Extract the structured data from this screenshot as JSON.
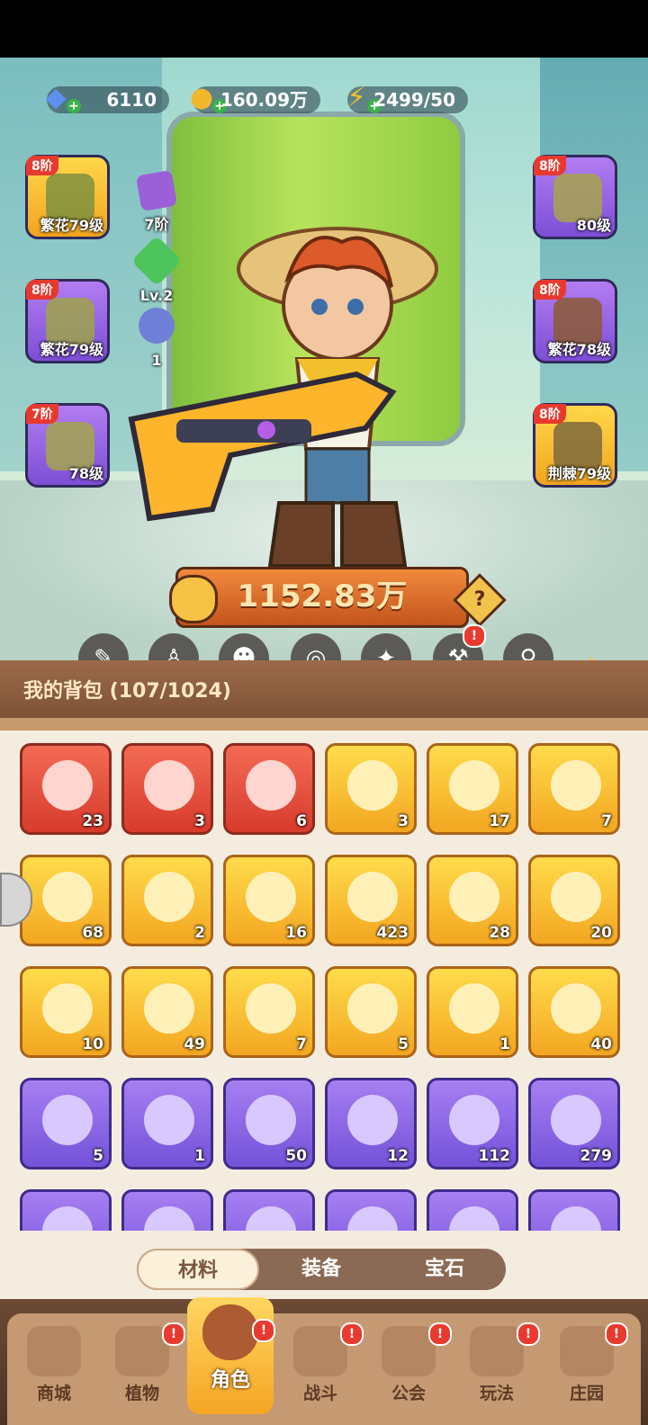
{
  "resources": [
    {
      "name": "diamond",
      "icon": "diamond-icon",
      "value": "6110"
    },
    {
      "name": "coin",
      "icon": "coin-icon",
      "value": "160.09万"
    },
    {
      "name": "energy",
      "icon": "lightning-icon",
      "value": "2499/50"
    }
  ],
  "equipment_left": [
    {
      "tier": "8阶",
      "level": "繁花79级",
      "color": "gold",
      "icon": "hat-icon"
    },
    {
      "tier": "8阶",
      "level": "繁花79级",
      "color": "purple",
      "icon": "gloves-icon"
    },
    {
      "tier": "7阶",
      "level": "78级",
      "color": "purple",
      "icon": "shorts-icon"
    }
  ],
  "equipment_right": [
    {
      "tier": "8阶",
      "level": "80级",
      "color": "purple",
      "icon": "jacket-icon"
    },
    {
      "tier": "8阶",
      "level": "繁花78级",
      "color": "purple",
      "icon": "belt-icon"
    },
    {
      "tier": "8阶",
      "level": "荆棘79级",
      "color": "gold",
      "icon": "boots-icon"
    }
  ],
  "mini_items": [
    {
      "label": "7阶",
      "icon": "pet-box-icon"
    },
    {
      "label": "Lv.2",
      "icon": "green-gem-icon"
    },
    {
      "label": "1",
      "icon": "cosmic-orb-icon"
    }
  ],
  "power": {
    "value": "1152.83万",
    "help": "?"
  },
  "tabs": [
    {
      "label": "武器",
      "icon": "weapon-icon",
      "alert": false
    },
    {
      "label": "时装",
      "icon": "costume-icon",
      "alert": false
    },
    {
      "label": "宠物",
      "icon": "pet-icon",
      "alert": false
    },
    {
      "label": "装饰",
      "icon": "mask-icon",
      "alert": false
    },
    {
      "label": "天赋",
      "icon": "talent-icon",
      "alert": false
    },
    {
      "label": "装备",
      "icon": "equipment-icon",
      "alert": true
    },
    {
      "label": "体魄",
      "icon": "physique-icon",
      "alert": false
    }
  ],
  "bag": {
    "title": "我的背包 (107/1024)"
  },
  "items": [
    {
      "count": "23",
      "color": "red",
      "icon": "star-crystal-icon"
    },
    {
      "count": "3",
      "color": "red",
      "icon": "red-potion-icon"
    },
    {
      "count": "6",
      "color": "red",
      "icon": "green-capsule-icon"
    },
    {
      "count": "3",
      "color": "gold",
      "icon": "water-drop-icon"
    },
    {
      "count": "17",
      "color": "gold",
      "icon": "red-key-icon"
    },
    {
      "count": "7",
      "color": "gold",
      "icon": "green-key-icon"
    },
    {
      "count": "68",
      "color": "gold",
      "icon": "prism-icon"
    },
    {
      "count": "2",
      "color": "gold",
      "icon": "golden-seed-icon"
    },
    {
      "count": "16",
      "color": "gold",
      "icon": "rune-stone-icon"
    },
    {
      "count": "423",
      "color": "gold",
      "icon": "orange-potion-icon"
    },
    {
      "count": "28",
      "color": "gold",
      "icon": "ore-nugget-icon"
    },
    {
      "count": "20",
      "color": "gold",
      "icon": "flower-pot-icon"
    },
    {
      "count": "10",
      "color": "gold",
      "icon": "sprayer-icon"
    },
    {
      "count": "49",
      "color": "gold",
      "icon": "spell-book-icon"
    },
    {
      "count": "7",
      "color": "gold",
      "icon": "honey-jar-icon"
    },
    {
      "count": "5",
      "color": "gold",
      "icon": "owl-puzzle-icon"
    },
    {
      "count": "1",
      "color": "gold",
      "icon": "golden-flower-icon"
    },
    {
      "count": "40",
      "color": "gold",
      "icon": "star-charm-icon"
    },
    {
      "count": "5",
      "color": "purple",
      "icon": "purple-potion-icon"
    },
    {
      "count": "1",
      "color": "purple",
      "icon": "silver-key-icon"
    },
    {
      "count": "50",
      "color": "purple",
      "icon": "lightning-badge-icon"
    },
    {
      "count": "12",
      "color": "purple",
      "icon": "blue-leaf-icon"
    },
    {
      "count": "112",
      "color": "purple",
      "icon": "green-scroll-icon"
    },
    {
      "count": "279",
      "color": "purple",
      "icon": "purple-scroll-icon"
    },
    {
      "count": "",
      "color": "purple",
      "icon": "partial-item-icon"
    },
    {
      "count": "",
      "color": "purple",
      "icon": "partial-item-icon"
    },
    {
      "count": "",
      "color": "purple",
      "icon": "partial-item-icon"
    },
    {
      "count": "",
      "color": "purple",
      "icon": "partial-item-icon"
    },
    {
      "count": "",
      "color": "purple",
      "icon": "partial-item-icon"
    },
    {
      "count": "",
      "color": "purple",
      "icon": "partial-item-icon"
    }
  ],
  "segments": [
    {
      "label": "材料",
      "active": true
    },
    {
      "label": "装备",
      "active": false
    },
    {
      "label": "宝石",
      "active": false
    }
  ],
  "nav": [
    {
      "label": "商城",
      "icon": "shop-icon",
      "alert": false,
      "active": false
    },
    {
      "label": "植物",
      "icon": "plant-icon",
      "alert": true,
      "active": false
    },
    {
      "label": "角色",
      "icon": "character-icon",
      "alert": true,
      "active": true
    },
    {
      "label": "战斗",
      "icon": "battle-icon",
      "alert": true,
      "active": false
    },
    {
      "label": "公会",
      "icon": "guild-icon",
      "alert": true,
      "active": false
    },
    {
      "label": "玩法",
      "icon": "gameplay-icon",
      "alert": true,
      "active": false
    },
    {
      "label": "庄园",
      "icon": "manor-icon",
      "alert": true,
      "active": false
    }
  ],
  "alert_mark": "!"
}
